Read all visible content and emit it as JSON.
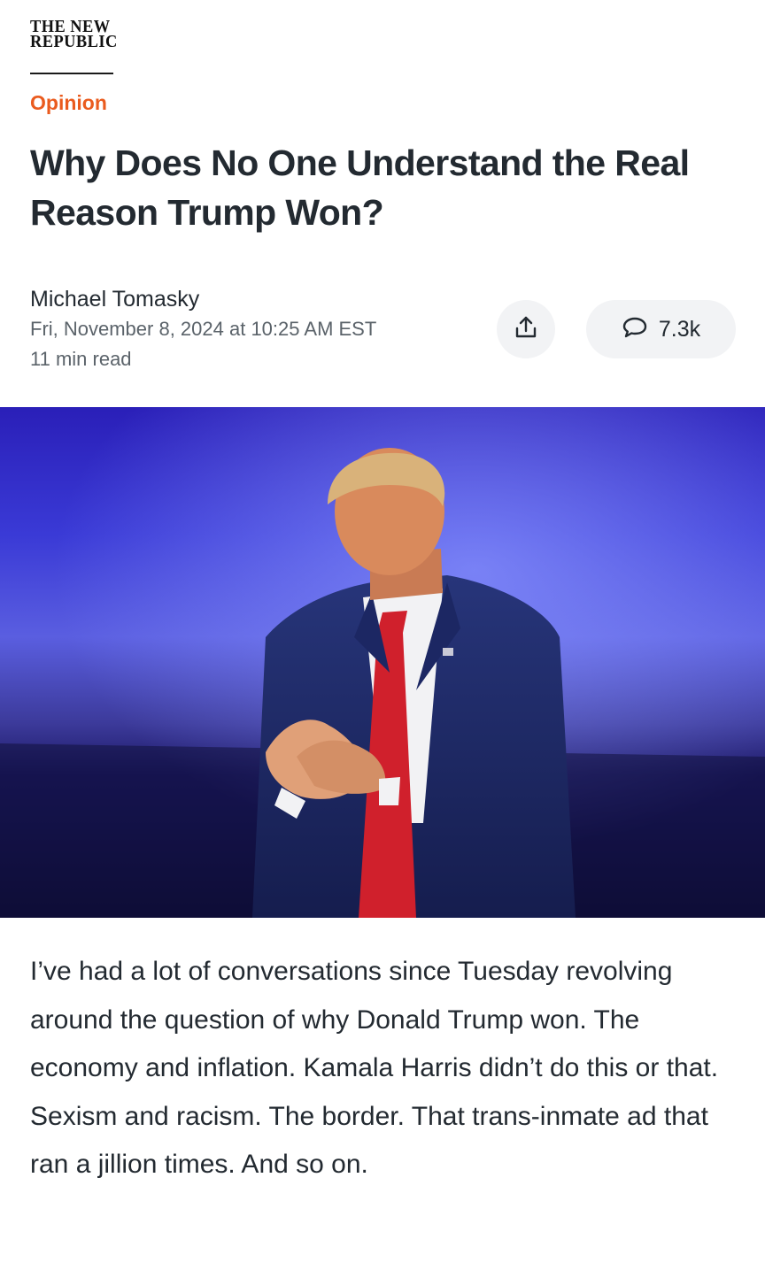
{
  "publication": {
    "logo_line1": "THE NEW",
    "logo_line2": "REPUBLIC"
  },
  "article": {
    "section": "Opinion",
    "headline": "Why Does No One Understand the Real Reason Trump Won?",
    "author": "Michael Tomasky",
    "date": "Fri, November 8, 2024 at 10:25 AM EST",
    "read_time": "11 min read",
    "body": "I’ve had a lot of conversations since Tuesday revolving around the question of why Donald Trump won. The economy and inflation. Kamala Harris didn’t do this or that. Sexism and racism. The border. That trans-inmate ad that ran a jillion times. And so on."
  },
  "actions": {
    "share_icon": "share-icon",
    "comment_icon": "comment-bubble-icon",
    "comments_count": "7.3k"
  },
  "colors": {
    "section_accent": "#ea5b1e",
    "headline_text": "#232a31",
    "meta_text": "#5b636a",
    "button_background": "#f2f3f5"
  }
}
